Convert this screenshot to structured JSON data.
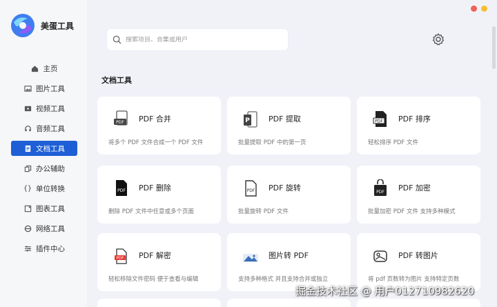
{
  "app": {
    "name": "美蛋工具"
  },
  "window_controls": {
    "close_color": "#f25f58",
    "minimize_color": "#f9be2f"
  },
  "search": {
    "placeholder": "搜索项目、合集或用户"
  },
  "sidebar": {
    "items": [
      {
        "label": "主页",
        "icon": "home-icon",
        "active": false
      },
      {
        "label": "图片工具",
        "icon": "image-icon",
        "active": false
      },
      {
        "label": "视频工具",
        "icon": "video-icon",
        "active": false
      },
      {
        "label": "音频工具",
        "icon": "audio-icon",
        "active": false
      },
      {
        "label": "文档工具",
        "icon": "document-icon",
        "active": true
      },
      {
        "label": "办公辅助",
        "icon": "copy-icon",
        "active": false
      },
      {
        "label": "单位转换",
        "icon": "braces-icon",
        "active": false
      },
      {
        "label": "图表工具",
        "icon": "chart-icon",
        "active": false
      },
      {
        "label": "网络工具",
        "icon": "browser-icon",
        "active": false
      },
      {
        "label": "插件中心",
        "icon": "sliders-icon",
        "active": false
      }
    ]
  },
  "main": {
    "section_title": "文档工具",
    "tools": [
      {
        "title": "PDF 合并",
        "desc": "将多个 PDF 文件合成一个 PDF 文件",
        "icon": "pdf-merge-icon"
      },
      {
        "title": "PDF 提取",
        "desc": "批量提取 PDF 中的第一页",
        "icon": "pdf-extract-icon"
      },
      {
        "title": "PDF 排序",
        "desc": "轻松排序 PDF 文件",
        "icon": "pdf-sort-icon"
      },
      {
        "title": "PDF 删除",
        "desc": "删除 PDF 文件中任意或多个页面",
        "icon": "pdf-delete-icon"
      },
      {
        "title": "PDF 旋转",
        "desc": "批量旋转 PDF 文件",
        "icon": "pdf-rotate-icon"
      },
      {
        "title": "PDF 加密",
        "desc": "批量加密 PDF 文件 支持多种模式",
        "icon": "pdf-encrypt-icon"
      },
      {
        "title": "PDF 解密",
        "desc": "轻松移除文件密码 便于查看与编辑",
        "icon": "pdf-decrypt-icon"
      },
      {
        "title": "图片转 PDF",
        "desc": "支持多种格式 并且支持合并或独立",
        "icon": "image-to-pdf-icon"
      },
      {
        "title": "PDF 转图片",
        "desc": "将 pdf 页数转为图片 支持特定页数",
        "icon": "pdf-to-image-icon"
      }
    ]
  },
  "watermark": "掘金技术社区 @ 用户012710982620",
  "accent_color": "#1e5fd6"
}
